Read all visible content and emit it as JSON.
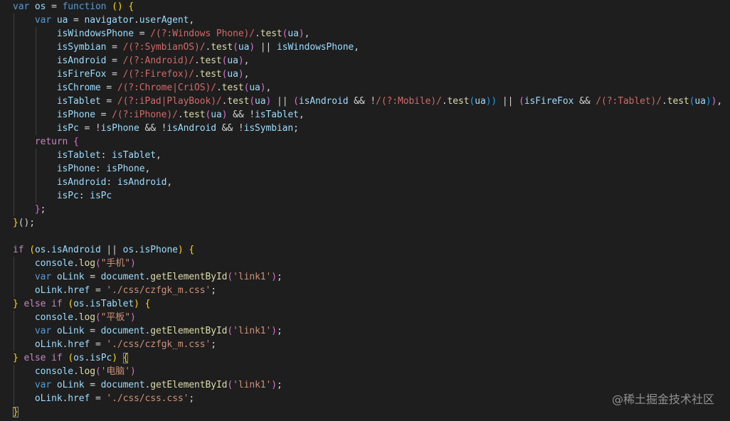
{
  "editor": {
    "background": "#1e1e1e",
    "lines": [
      [
        [
          "k",
          "var"
        ],
        [
          "p",
          " "
        ],
        [
          "v",
          "os"
        ],
        [
          "p",
          " = "
        ],
        [
          "k",
          "function"
        ],
        [
          "p",
          " "
        ],
        [
          "y",
          "()"
        ],
        [
          "p",
          " "
        ],
        [
          "y",
          "{"
        ]
      ],
      [
        [
          "p",
          "    "
        ],
        [
          "k",
          "var"
        ],
        [
          "p",
          " "
        ],
        [
          "v",
          "ua"
        ],
        [
          "p",
          " = "
        ],
        [
          "v",
          "navigator"
        ],
        [
          "p",
          "."
        ],
        [
          "v",
          "userAgent"
        ],
        [
          "p",
          ","
        ]
      ],
      [
        [
          "p",
          "        "
        ],
        [
          "v",
          "isWindowsPhone"
        ],
        [
          "p",
          " = "
        ],
        [
          "r",
          "/(?:Windows Phone)/"
        ],
        [
          "p",
          "."
        ],
        [
          "f",
          "test"
        ],
        [
          "pk",
          "("
        ],
        [
          "v",
          "ua"
        ],
        [
          "pk",
          ")"
        ],
        [
          "p",
          ","
        ]
      ],
      [
        [
          "p",
          "        "
        ],
        [
          "v",
          "isSymbian"
        ],
        [
          "p",
          " = "
        ],
        [
          "r",
          "/(?:SymbianOS)/"
        ],
        [
          "p",
          "."
        ],
        [
          "f",
          "test"
        ],
        [
          "pk",
          "("
        ],
        [
          "v",
          "ua"
        ],
        [
          "pk",
          ")"
        ],
        [
          "p",
          " || "
        ],
        [
          "v",
          "isWindowsPhone"
        ],
        [
          "p",
          ","
        ]
      ],
      [
        [
          "p",
          "        "
        ],
        [
          "v",
          "isAndroid"
        ],
        [
          "p",
          " = "
        ],
        [
          "r",
          "/(?:Android)/"
        ],
        [
          "p",
          "."
        ],
        [
          "f",
          "test"
        ],
        [
          "pk",
          "("
        ],
        [
          "v",
          "ua"
        ],
        [
          "pk",
          ")"
        ],
        [
          "p",
          ","
        ]
      ],
      [
        [
          "p",
          "        "
        ],
        [
          "v",
          "isFireFox"
        ],
        [
          "p",
          " = "
        ],
        [
          "r",
          "/(?:Firefox)/"
        ],
        [
          "p",
          "."
        ],
        [
          "f",
          "test"
        ],
        [
          "pk",
          "("
        ],
        [
          "v",
          "ua"
        ],
        [
          "pk",
          ")"
        ],
        [
          "p",
          ","
        ]
      ],
      [
        [
          "p",
          "        "
        ],
        [
          "v",
          "isChrome"
        ],
        [
          "p",
          " = "
        ],
        [
          "r",
          "/(?:Chrome|CriOS)/"
        ],
        [
          "p",
          "."
        ],
        [
          "f",
          "test"
        ],
        [
          "pk",
          "("
        ],
        [
          "v",
          "ua"
        ],
        [
          "pk",
          ")"
        ],
        [
          "p",
          ","
        ]
      ],
      [
        [
          "p",
          "        "
        ],
        [
          "v",
          "isTablet"
        ],
        [
          "p",
          " = "
        ],
        [
          "r",
          "/(?:iPad|PlayBook)/"
        ],
        [
          "p",
          "."
        ],
        [
          "f",
          "test"
        ],
        [
          "pk",
          "("
        ],
        [
          "v",
          "ua"
        ],
        [
          "pk",
          ")"
        ],
        [
          "p",
          " || "
        ],
        [
          "pk",
          "("
        ],
        [
          "v",
          "isAndroid"
        ],
        [
          "p",
          " && !"
        ],
        [
          "r",
          "/(?:Mobile)/"
        ],
        [
          "p",
          "."
        ],
        [
          "f",
          "test"
        ],
        [
          "bl",
          "("
        ],
        [
          "v",
          "ua"
        ],
        [
          "bl",
          "))"
        ],
        [
          "p",
          " || "
        ],
        [
          "pk",
          "("
        ],
        [
          "v",
          "isFireFox"
        ],
        [
          "p",
          " && "
        ],
        [
          "r",
          "/(?:Tablet)/"
        ],
        [
          "p",
          "."
        ],
        [
          "f",
          "test"
        ],
        [
          "bl",
          "("
        ],
        [
          "v",
          "ua"
        ],
        [
          "bl",
          ")"
        ],
        [
          "pk",
          ")"
        ],
        [
          "p",
          ","
        ]
      ],
      [
        [
          "p",
          "        "
        ],
        [
          "v",
          "isPhone"
        ],
        [
          "p",
          " = "
        ],
        [
          "r",
          "/(?:iPhone)/"
        ],
        [
          "p",
          "."
        ],
        [
          "f",
          "test"
        ],
        [
          "pk",
          "("
        ],
        [
          "v",
          "ua"
        ],
        [
          "pk",
          ")"
        ],
        [
          "p",
          " && !"
        ],
        [
          "v",
          "isTablet"
        ],
        [
          "p",
          ","
        ]
      ],
      [
        [
          "p",
          "        "
        ],
        [
          "v",
          "isPc"
        ],
        [
          "p",
          " = !"
        ],
        [
          "v",
          "isPhone"
        ],
        [
          "p",
          " && !"
        ],
        [
          "v",
          "isAndroid"
        ],
        [
          "p",
          " && !"
        ],
        [
          "v",
          "isSymbian"
        ],
        [
          "p",
          ";"
        ]
      ],
      [
        [
          "p",
          "    "
        ],
        [
          "c",
          "return"
        ],
        [
          "p",
          " "
        ],
        [
          "pk",
          "{"
        ]
      ],
      [
        [
          "p",
          "        "
        ],
        [
          "v",
          "isTablet"
        ],
        [
          "p",
          ": "
        ],
        [
          "v",
          "isTablet"
        ],
        [
          "p",
          ","
        ]
      ],
      [
        [
          "p",
          "        "
        ],
        [
          "v",
          "isPhone"
        ],
        [
          "p",
          ": "
        ],
        [
          "v",
          "isPhone"
        ],
        [
          "p",
          ","
        ]
      ],
      [
        [
          "p",
          "        "
        ],
        [
          "v",
          "isAndroid"
        ],
        [
          "p",
          ": "
        ],
        [
          "v",
          "isAndroid"
        ],
        [
          "p",
          ","
        ]
      ],
      [
        [
          "p",
          "        "
        ],
        [
          "v",
          "isPc"
        ],
        [
          "p",
          ": "
        ],
        [
          "v",
          "isPc"
        ]
      ],
      [
        [
          "p",
          "    "
        ],
        [
          "pk",
          "}"
        ],
        [
          "p",
          ";"
        ]
      ],
      [
        [
          "y",
          "}"
        ],
        [
          "p",
          "()"
        ],
        [
          "p",
          ";"
        ]
      ],
      [],
      [
        [
          "c",
          "if"
        ],
        [
          "p",
          " "
        ],
        [
          "y",
          "("
        ],
        [
          "v",
          "os"
        ],
        [
          "p",
          "."
        ],
        [
          "v",
          "isAndroid"
        ],
        [
          "p",
          " || "
        ],
        [
          "v",
          "os"
        ],
        [
          "p",
          "."
        ],
        [
          "v",
          "isPhone"
        ],
        [
          "y",
          ")"
        ],
        [
          "p",
          " "
        ],
        [
          "y",
          "{"
        ]
      ],
      [
        [
          "p",
          "    "
        ],
        [
          "v",
          "console"
        ],
        [
          "p",
          "."
        ],
        [
          "f",
          "log"
        ],
        [
          "pk",
          "("
        ],
        [
          "s",
          "\"手机\""
        ],
        [
          "pk",
          ")"
        ]
      ],
      [
        [
          "p",
          "    "
        ],
        [
          "k",
          "var"
        ],
        [
          "p",
          " "
        ],
        [
          "v",
          "oLink"
        ],
        [
          "p",
          " = "
        ],
        [
          "v",
          "document"
        ],
        [
          "p",
          "."
        ],
        [
          "f",
          "getElementById"
        ],
        [
          "pk",
          "("
        ],
        [
          "s",
          "'link1'"
        ],
        [
          "pk",
          ")"
        ],
        [
          "p",
          ";"
        ]
      ],
      [
        [
          "p",
          "    "
        ],
        [
          "v",
          "oLink"
        ],
        [
          "p",
          "."
        ],
        [
          "v",
          "href"
        ],
        [
          "p",
          " = "
        ],
        [
          "s",
          "'./css/czfgk_m.css'"
        ],
        [
          "p",
          ";"
        ]
      ],
      [
        [
          "y",
          "}"
        ],
        [
          "p",
          " "
        ],
        [
          "c",
          "else"
        ],
        [
          "p",
          " "
        ],
        [
          "c",
          "if"
        ],
        [
          "p",
          " "
        ],
        [
          "y",
          "("
        ],
        [
          "v",
          "os"
        ],
        [
          "p",
          "."
        ],
        [
          "v",
          "isTablet"
        ],
        [
          "y",
          ")"
        ],
        [
          "p",
          " "
        ],
        [
          "y",
          "{"
        ]
      ],
      [
        [
          "p",
          "    "
        ],
        [
          "v",
          "console"
        ],
        [
          "p",
          "."
        ],
        [
          "f",
          "log"
        ],
        [
          "pk",
          "("
        ],
        [
          "s",
          "\"平板\""
        ],
        [
          "pk",
          ")"
        ]
      ],
      [
        [
          "p",
          "    "
        ],
        [
          "k",
          "var"
        ],
        [
          "p",
          " "
        ],
        [
          "v",
          "oLink"
        ],
        [
          "p",
          " = "
        ],
        [
          "v",
          "document"
        ],
        [
          "p",
          "."
        ],
        [
          "f",
          "getElementById"
        ],
        [
          "pk",
          "("
        ],
        [
          "s",
          "'link1'"
        ],
        [
          "pk",
          ")"
        ],
        [
          "p",
          ";"
        ]
      ],
      [
        [
          "p",
          "    "
        ],
        [
          "v",
          "oLink"
        ],
        [
          "p",
          "."
        ],
        [
          "v",
          "href"
        ],
        [
          "p",
          " = "
        ],
        [
          "s",
          "'./css/czfgk_m.css'"
        ],
        [
          "p",
          ";"
        ]
      ],
      [
        [
          "y",
          "}"
        ],
        [
          "p",
          " "
        ],
        [
          "c",
          "else"
        ],
        [
          "p",
          " "
        ],
        [
          "c",
          "if"
        ],
        [
          "p",
          " "
        ],
        [
          "y",
          "("
        ],
        [
          "v",
          "os"
        ],
        [
          "p",
          "."
        ],
        [
          "v",
          "isPc"
        ],
        [
          "y",
          ")"
        ],
        [
          "p",
          " "
        ],
        [
          "ym",
          "{"
        ]
      ],
      [
        [
          "p",
          "    "
        ],
        [
          "v",
          "console"
        ],
        [
          "p",
          "."
        ],
        [
          "f",
          "log"
        ],
        [
          "pk",
          "("
        ],
        [
          "s",
          "'电脑'"
        ],
        [
          "pk",
          ")"
        ]
      ],
      [
        [
          "p",
          "    "
        ],
        [
          "k",
          "var"
        ],
        [
          "p",
          " "
        ],
        [
          "v",
          "oLink"
        ],
        [
          "p",
          " = "
        ],
        [
          "v",
          "document"
        ],
        [
          "p",
          "."
        ],
        [
          "f",
          "getElementById"
        ],
        [
          "pk",
          "("
        ],
        [
          "s",
          "'link1'"
        ],
        [
          "pk",
          ")"
        ],
        [
          "p",
          ";"
        ]
      ],
      [
        [
          "p",
          "    "
        ],
        [
          "v",
          "oLink"
        ],
        [
          "p",
          "."
        ],
        [
          "v",
          "href"
        ],
        [
          "p",
          " = "
        ],
        [
          "s",
          "'./css/css.css'"
        ],
        [
          "p",
          ";"
        ]
      ],
      [
        [
          "ym",
          "}"
        ]
      ]
    ]
  },
  "watermark": "@稀土掘金技术社区"
}
